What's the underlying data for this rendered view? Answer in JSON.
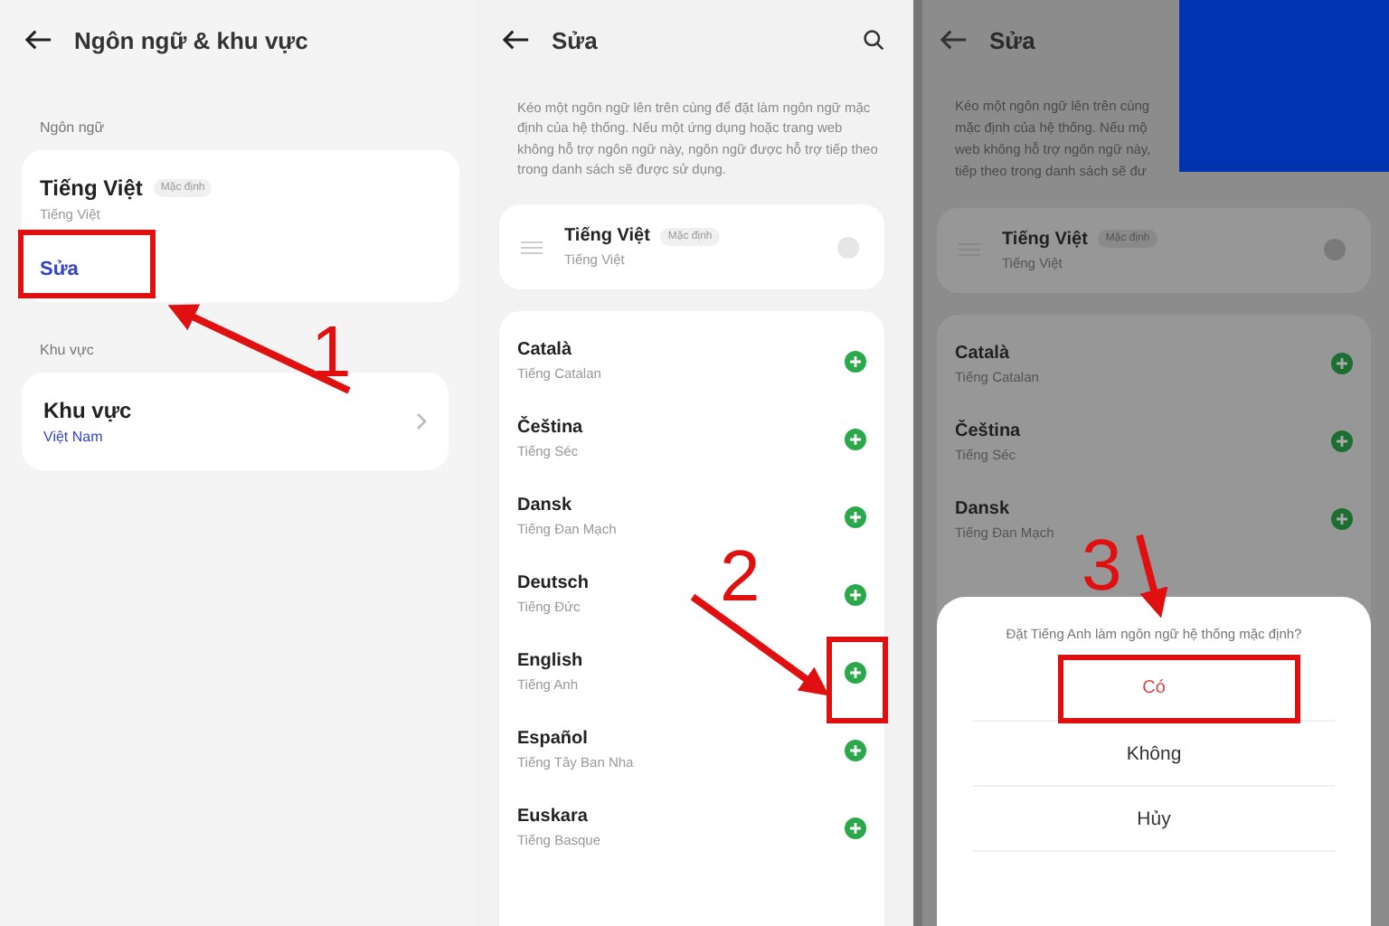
{
  "screen_1": {
    "title": "Ngôn ngữ & khu vực",
    "language_section": {
      "label": "Ngôn ngữ",
      "name": "Tiếng Việt",
      "badge": "Mặc định",
      "native": "Tiếng Việt",
      "edit_link": "Sửa"
    },
    "region_section": {
      "label": "Khu vực",
      "name": "Khu vực",
      "value": "Việt Nam"
    }
  },
  "screen_2": {
    "title": "Sửa",
    "description": "Kéo một ngôn ngữ lên trên cùng để đặt làm ngôn ngữ mặc định của hệ thống. Nếu một ứng dụng hoặc trang web không hỗ trợ ngôn ngữ này, ngôn ngữ được hỗ trợ tiếp theo trong danh sách sẽ được sử dụng.",
    "current": {
      "name": "Tiếng Việt",
      "badge": "Mặc định",
      "native": "Tiếng Việt"
    },
    "languages": [
      {
        "name": "Català",
        "native": "Tiếng Catalan"
      },
      {
        "name": "Čeština",
        "native": "Tiếng Séc"
      },
      {
        "name": "Dansk",
        "native": "Tiếng Đan Mạch"
      },
      {
        "name": "Deutsch",
        "native": "Tiếng Đức"
      },
      {
        "name": "English",
        "native": "Tiếng Anh"
      },
      {
        "name": "Español",
        "native": "Tiếng Tây Ban Nha"
      },
      {
        "name": "Euskara",
        "native": "Tiếng Basque"
      }
    ]
  },
  "screen_3": {
    "title": "Sửa",
    "description_lines": [
      "Kéo một ngôn ngữ lên trên cùng",
      "mặc định của hệ thống. Nếu mộ",
      "web không hỗ trợ ngôn ngữ này,",
      "tiếp theo trong danh sách sẽ đư"
    ],
    "current": {
      "name": "Tiếng Việt",
      "badge": "Mặc định",
      "native": "Tiếng Việt"
    },
    "languages": [
      {
        "name": "Català",
        "native": "Tiếng Catalan"
      },
      {
        "name": "Čeština",
        "native": "Tiếng Séc"
      },
      {
        "name": "Dansk",
        "native": "Tiếng Đan Mạch"
      }
    ],
    "dialog": {
      "question": "Đặt Tiếng Anh làm ngôn ngữ hệ thống mặc định?",
      "options": [
        {
          "label": "Có",
          "kind": "confirm"
        },
        {
          "label": "Không",
          "kind": "normal"
        },
        {
          "label": "Hủy",
          "kind": "normal"
        }
      ]
    }
  },
  "annotations": {
    "steps": [
      "1",
      "2",
      "3"
    ]
  }
}
